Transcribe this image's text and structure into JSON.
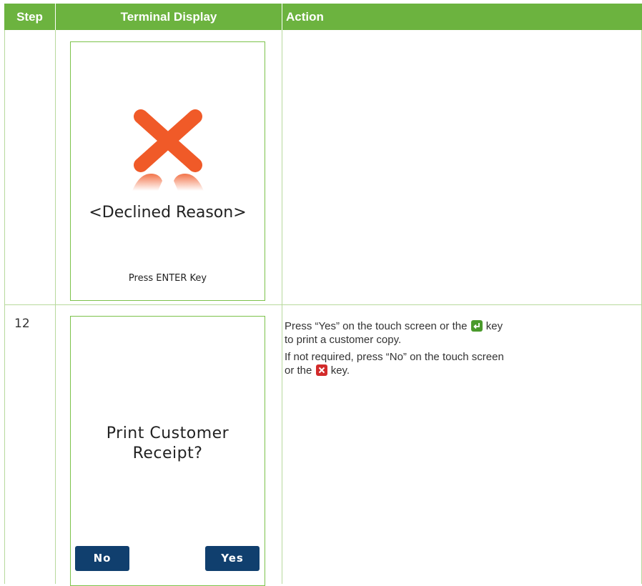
{
  "header": {
    "step": "Step",
    "terminal_display": "Terminal Display",
    "action": "Action"
  },
  "rows": [
    {
      "step": "",
      "screen": {
        "icon": "decline-x-icon",
        "reason": "<Declined Reason>",
        "footer": "Press ENTER Key"
      },
      "action": ""
    },
    {
      "step": "12",
      "screen": {
        "prompt": "Print Customer Receipt?",
        "no_button": "No",
        "yes_button": "Yes"
      },
      "action": {
        "line1_pre": "Press “Yes” on the touch screen or the",
        "line1_post": "key",
        "line2": "to print a customer copy.",
        "line3": "If not required, press “No” on the touch screen",
        "line4_pre": "or the",
        "line4_post": "key."
      }
    }
  ],
  "colors": {
    "header_green": "#6cb33f",
    "decline_orange": "#f05a28",
    "button_navy": "#103f6e",
    "enter_key_green": "#4a9a2c",
    "cancel_key_red": "#d22b2b"
  }
}
